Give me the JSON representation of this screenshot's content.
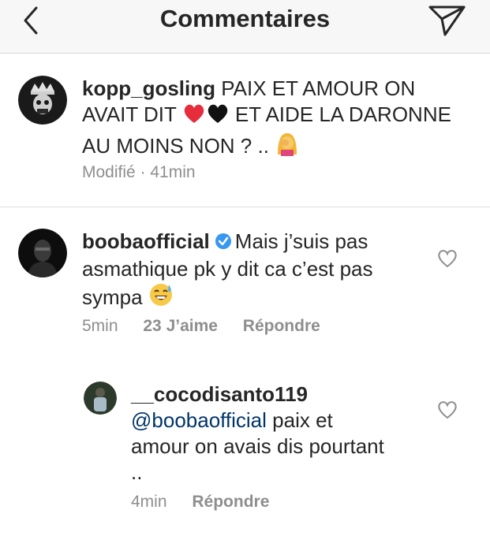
{
  "header": {
    "title": "Commentaires"
  },
  "comments": [
    {
      "username": "kopp_gosling",
      "text_part1": " PAIX ET AMOUR ON AVAIT DIT ",
      "text_part2": " ET AIDE LA DARONNE AU MOINS NON ? .. ",
      "emoji": [
        "red-heart",
        "black-heart",
        "woman-facepalming"
      ],
      "meta": {
        "edited": "Modifié",
        "separator": " · ",
        "time": "41min"
      }
    },
    {
      "username": "boobaofficial",
      "verified": true,
      "text": "Mais j’suis pas asmathique pk y dit ca c’est pas sympa ",
      "emoji": [
        "grinning-sweat"
      ],
      "meta": {
        "time": "5min",
        "likes": "23 J’aime",
        "reply": "Répondre"
      }
    },
    {
      "username": "__cocodisanto119",
      "mention": "@boobaofficial",
      "text": " paix et amour on avais dis pourtant ..",
      "meta": {
        "time": "4min",
        "reply": "Répondre"
      }
    }
  ],
  "colors": {
    "text": "#262626",
    "muted": "#8e8e8e",
    "mention": "#003569",
    "verified": "#3897f0"
  }
}
